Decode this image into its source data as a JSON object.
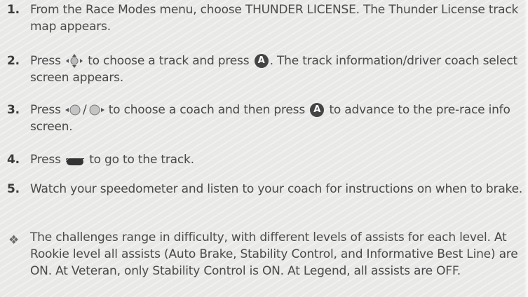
{
  "steps": [
    {
      "num": "1.",
      "text": "From the Race Modes menu, choose THUNDER LICENSE. The Thunder License track map appears."
    },
    {
      "num": "2.",
      "pre": "Press",
      "mid": "to choose a track and press",
      "post": ". The track information/driver coach select screen appears."
    },
    {
      "num": "3.",
      "pre": "Press",
      "mid": "to choose a coach and then press",
      "post": "to advance to the pre-race info screen."
    },
    {
      "num": "4.",
      "pre": "Press",
      "post": "to go to the track."
    },
    {
      "num": "5.",
      "text": "Watch your speedometer and listen to your coach for instructions on when to brake."
    }
  ],
  "note": {
    "bullet": "❖",
    "text": "The challenges range in difficulty, with different levels of assists for each level. At Rookie level all assists (Auto Brake, Stability Control, and Informative Best Line) are ON. At Veteran, only Stability Control is ON. At Legend, all assists are OFF."
  },
  "icons": {
    "a_button": "A",
    "start_label": "START",
    "slash": "/"
  }
}
